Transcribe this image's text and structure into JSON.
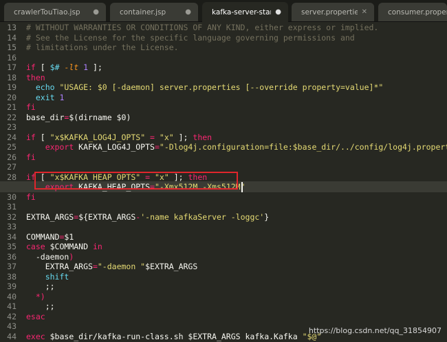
{
  "tabs": [
    {
      "label": "crawlerTouTiao.jsp",
      "icon": "●"
    },
    {
      "label": "container.jsp",
      "icon": "●"
    },
    {
      "label": "kafka-server-start.sh",
      "icon": "●"
    },
    {
      "label": "server.properties",
      "icon": "✕"
    },
    {
      "label": "consumer.properties",
      "icon": ""
    }
  ],
  "line_numbers": [
    "13",
    "14",
    "15",
    "16",
    "17",
    "18",
    "19",
    "20",
    "21",
    "22",
    "23",
    "24",
    "25",
    "26",
    "27",
    "28",
    "29",
    "30",
    "31",
    "32",
    "33",
    "34",
    "35",
    "36",
    "37",
    "38",
    "39",
    "40",
    "41",
    "42",
    "43",
    "44",
    "45"
  ],
  "code": {
    "l13": "# WITHOUT WARRANTIES OR CONDITIONS OF ANY KIND, either express or implied.",
    "l14": "# See the License for the specific language governing permissions and",
    "l15": "# limitations under the License.",
    "l17_if": "if",
    "l17_a": " [ ",
    "l17_var": "$#",
    "l17_b": " ",
    "l17_op": "-lt",
    "l17_c": " ",
    "l17_num": "1",
    "l17_d": " ];",
    "l18": "then",
    "l19_echo": "echo",
    "l19_str": "\"USAGE: $0 [-daemon] server.properties [--override property=value]*\"",
    "l20_exit": "exit",
    "l20_num": "1",
    "l21": "fi",
    "l22_a": "base_dir",
    "l22_b": "=",
    "l22_c": "$(",
    "l22_d": "dirname $0",
    "l22_e": ")",
    "l24_if": "if",
    "l24_a": " [ ",
    "l24_str1": "\"x$KAFKA_LOG4J_OPTS\"",
    "l24_b": " = ",
    "l24_str2": "\"x\"",
    "l24_c": " ]; ",
    "l24_then": "then",
    "l25_export": "export",
    "l25_name": " KAFKA_LOG4J_OPTS",
    "l25_eq": "=",
    "l25_str": "\"-Dlog4j.configuration=file:$base_dir/../config/log4j.properties\"",
    "l26": "fi",
    "l28_if": "if",
    "l28_a": " [ ",
    "l28_str1": "\"x$KAFKA_HEAP_OPTS\"",
    "l28_b": " = ",
    "l28_str2": "\"x\"",
    "l28_c": " ]; ",
    "l28_then": "then",
    "l29_export": "export",
    "l29_name": " KAFKA_HEAP_OPTS",
    "l29_eq": "=",
    "l29_str": "\"-Xmx512M -Xms512M\"",
    "l30": "fi",
    "l32_a": "EXTRA_ARGS",
    "l32_b": "=",
    "l32_c": "${EXTRA_ARGS",
    "l32_d": "-",
    "l32_e": "'-name kafkaServer -loggc'",
    "l32_f": "}",
    "l34_a": "COMMAND",
    "l34_b": "=",
    "l34_c": "$1",
    "l35_case": "case",
    "l35_var": " $COMMAND ",
    "l35_in": "in",
    "l36_a": "  -daemon",
    "l36_b": ")",
    "l37_a": "    EXTRA_ARGS",
    "l37_b": "=",
    "l37_str": "\"-daemon \"",
    "l37_var": "$EXTRA_ARGS",
    "l38": "    shift",
    "l39": "    ;;",
    "l40_a": "  *",
    "l40_b": ")",
    "l41": "    ;;",
    "l42": "esac",
    "l44_exec": "exec",
    "l44_a": " $base_dir/kafka-run-class.sh $EXTRA_ARGS kafka.Kafka ",
    "l44_str": "\"$@\""
  },
  "watermark": "https://blog.csdn.net/qq_31854907",
  "colors": {
    "background": "#272822",
    "comment": "#75715e",
    "keyword": "#f92672",
    "string": "#e6db74",
    "number": "#ae81ff",
    "builtin": "#66d9ef",
    "highlight_box": "#e0262c"
  }
}
